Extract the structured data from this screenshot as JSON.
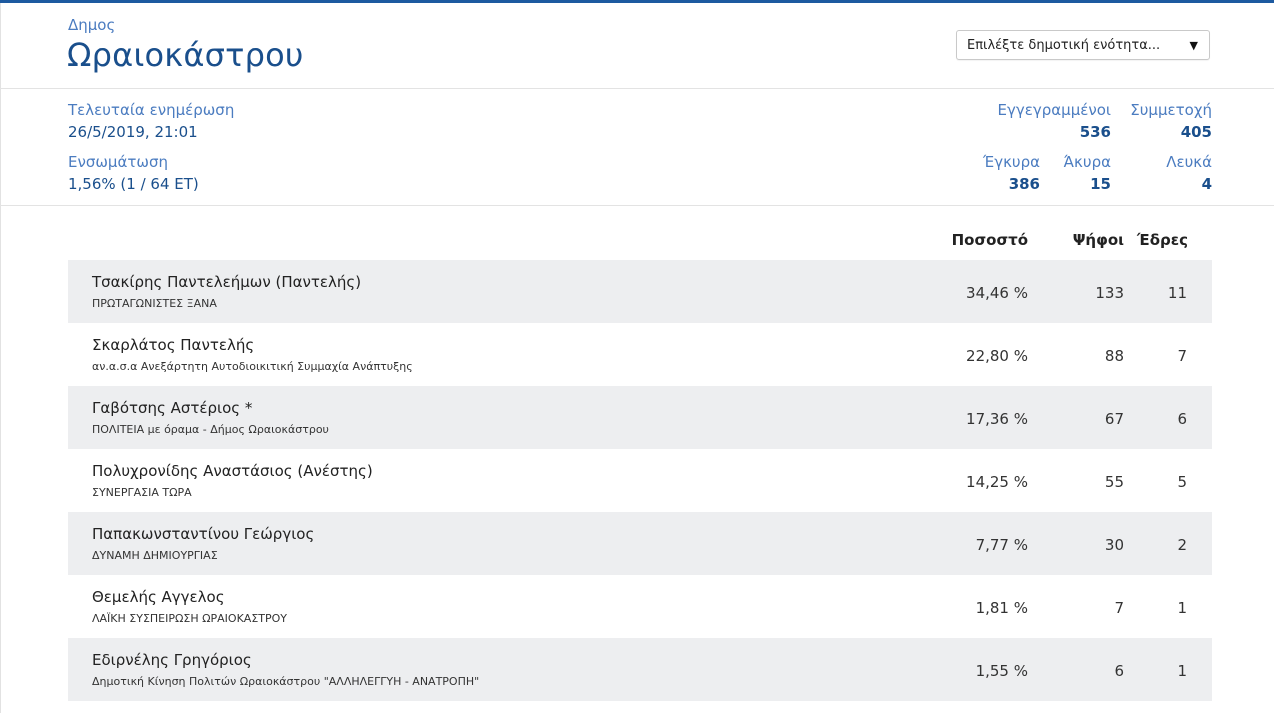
{
  "header": {
    "kicker": "Δημος",
    "title": "Ωραιοκάστρου",
    "select_placeholder": "Επιλέξτε δημοτική ενότητα...",
    "select_caret": "▼"
  },
  "stats": {
    "last_update_label": "Τελευταία ενημέρωση",
    "last_update_value": "26/5/2019, 21:01",
    "integration_label": "Ενσωμάτωση",
    "integration_value": "1,56% (1 / 64 ΕΤ)",
    "registered_label": "Εγγεγραμμένοι",
    "registered_value": "536",
    "turnout_label": "Συμμετοχή",
    "turnout_value": "405",
    "valid_label": "Έγκυρα",
    "valid_value": "386",
    "invalid_label": "Άκυρα",
    "invalid_value": "15",
    "blank_label": "Λευκά",
    "blank_value": "4"
  },
  "table": {
    "headers": {
      "percent": "Ποσοστό",
      "votes": "Ψήφοι",
      "seats": "Έδρες"
    },
    "rows": [
      {
        "name": "Τσακίρης Παντελεήμων (Παντελής)",
        "party": "ΠΡΩΤΑΓΩΝΙΣΤΕΣ ΞΑΝΑ",
        "percent": "34,46 %",
        "votes": "133",
        "seats": "11"
      },
      {
        "name": "Σκαρλάτος Παντελής",
        "party": "αν.α.σ.α Ανεξάρτητη Αυτοδιοικιτική Συμμαχία Ανάπτυξης",
        "percent": "22,80 %",
        "votes": "88",
        "seats": "7"
      },
      {
        "name": "Γαβότσης Αστέριος *",
        "party": "ΠΟΛΙΤΕΙΑ με όραμα - Δήμος Ωραιοκάστρου",
        "percent": "17,36 %",
        "votes": "67",
        "seats": "6"
      },
      {
        "name": "Πολυχρονίδης Αναστάσιος (Ανέστης)",
        "party": "ΣΥΝΕΡΓΑΣΙΑ ΤΩΡΑ",
        "percent": "14,25 %",
        "votes": "55",
        "seats": "5"
      },
      {
        "name": "Παπακωνσταντίνου Γεώργιος",
        "party": "ΔΥΝΑΜΗ ΔΗΜΙΟΥΡΓΙΑΣ",
        "percent": "7,77 %",
        "votes": "30",
        "seats": "2"
      },
      {
        "name": "Θεμελής Αγγελος",
        "party": "ΛΑΪΚΗ ΣΥΣΠΕΙΡΩΣΗ ΩΡΑΙΟΚΑΣΤΡΟΥ",
        "percent": "1,81 %",
        "votes": "7",
        "seats": "1"
      },
      {
        "name": "Εδιρνέλης Γρηγόριος",
        "party": "Δημοτική Κίνηση Πολιτών Ωραιοκάστρου \"ΑΛΛΗΛΕΓΓΥΗ - ΑΝΑΤΡΟΠΗ\"",
        "percent": "1,55 %",
        "votes": "6",
        "seats": "1"
      }
    ]
  },
  "colors": {
    "accent": "#1d5aa0",
    "label_blue": "#4b7cc0",
    "value_blue": "#1a4f8c",
    "row_shade": "#edeef0"
  }
}
